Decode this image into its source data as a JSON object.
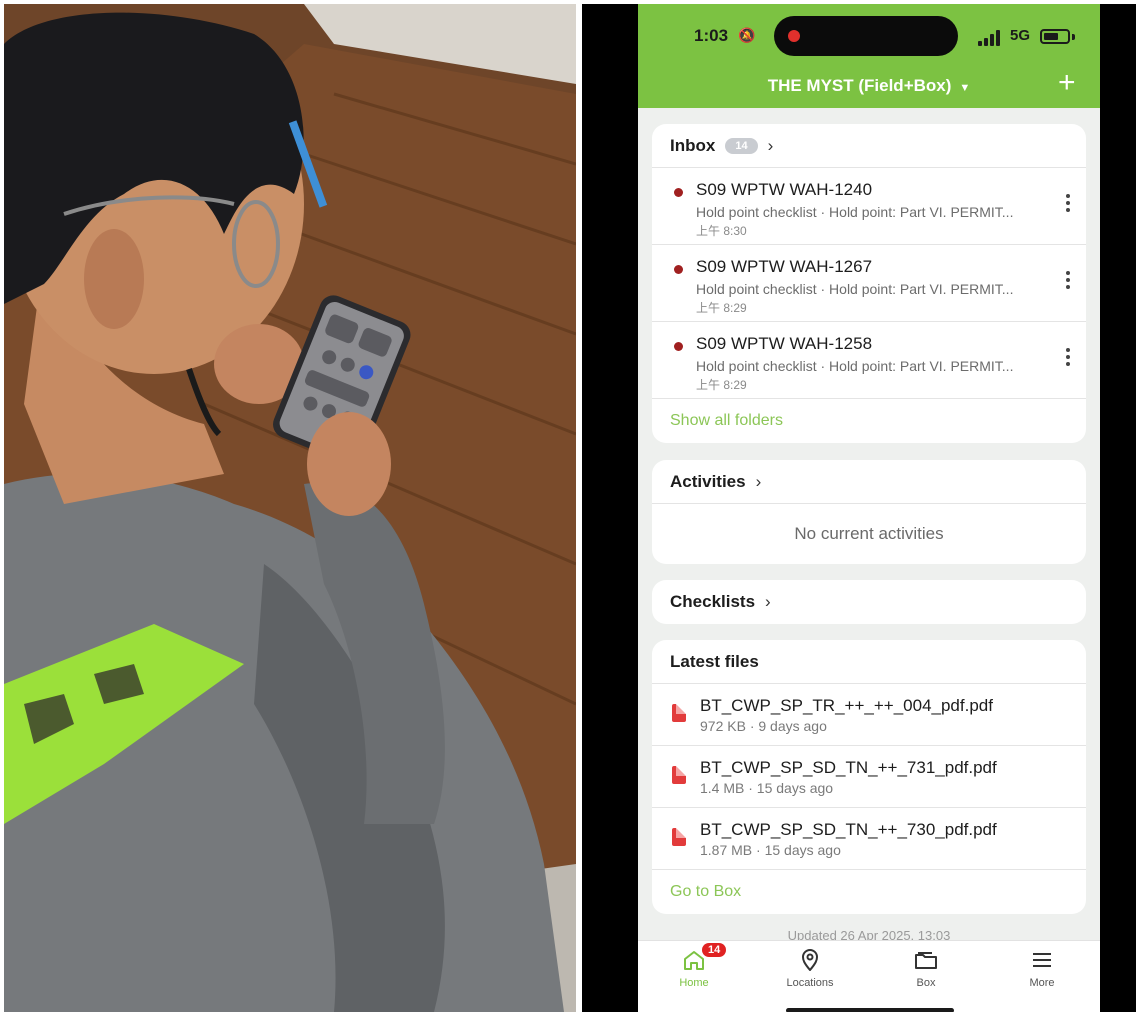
{
  "status_bar": {
    "time": "1:03",
    "network": "5G",
    "bell_icon": "bell-muted-icon"
  },
  "header": {
    "project_name": "THE MYST (Field+Box)",
    "add_label": "+"
  },
  "inbox": {
    "title": "Inbox",
    "badge": "14",
    "items": [
      {
        "title": "S09 WPTW WAH-1240",
        "subtitle": "Hold point checklist · Hold point: Part VI. PERMIT...",
        "time": "上午 8:30"
      },
      {
        "title": "S09 WPTW WAH-1267",
        "subtitle": "Hold point checklist · Hold point: Part VI. PERMIT...",
        "time": "上午 8:29"
      },
      {
        "title": "S09 WPTW WAH-1258",
        "subtitle": "Hold point checklist · Hold point: Part VI. PERMIT...",
        "time": "上午 8:29"
      }
    ],
    "show_all": "Show all folders"
  },
  "activities": {
    "title": "Activities",
    "empty": "No current activities"
  },
  "checklists": {
    "title": "Checklists"
  },
  "latest_files": {
    "title": "Latest files",
    "files": [
      {
        "name": "BT_CWP_SP_TR_++_++_004_pdf.pdf",
        "meta": "972 KB · 9 days ago"
      },
      {
        "name": "BT_CWP_SP_SD_TN_++_731_pdf.pdf",
        "meta": "1.4 MB · 15 days ago"
      },
      {
        "name": "BT_CWP_SP_SD_TN_++_730_pdf.pdf",
        "meta": "1.87 MB · 15 days ago"
      }
    ],
    "go_to_box": "Go to Box"
  },
  "updated_text": "Updated 26 Apr 2025, 13:03",
  "tabbar": {
    "home": "Home",
    "home_badge": "14",
    "locations": "Locations",
    "box": "Box",
    "more": "More"
  },
  "colors": {
    "brand_green": "#7cc242",
    "unread_dot": "#a02020",
    "badge_red": "#e02222",
    "pdf_red": "#e23b3b"
  }
}
